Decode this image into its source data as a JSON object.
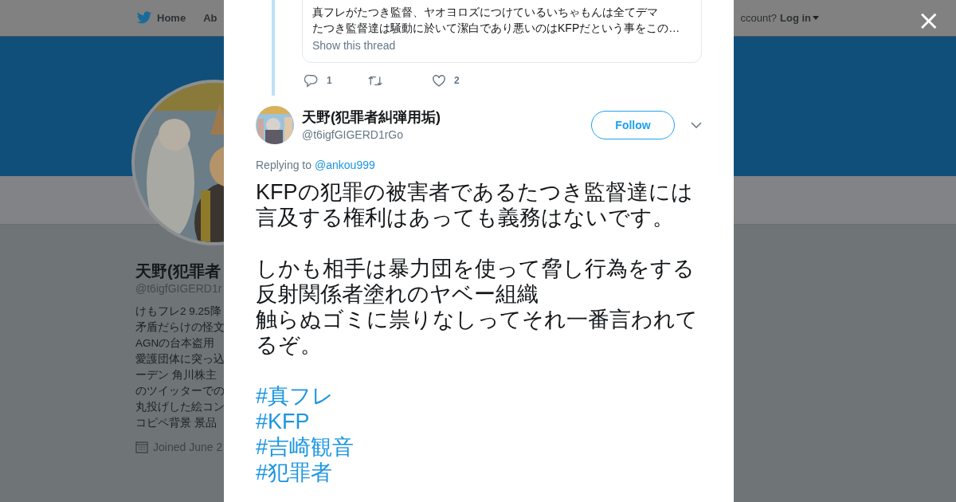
{
  "background_page": {
    "nav": {
      "home": "Home",
      "about": "Ab",
      "account_prompt": "ccount?",
      "login": "Log in"
    },
    "profile": {
      "name": "天野(犯罪者",
      "handle": "@t6igfGIGERD1r",
      "bio_lines": [
        "けもフレ2 9.25降",
        "矛盾だらけの怪文",
        "AGNの台本盗用",
        "愛護団体に突っ込",
        "ーデン 角川株主",
        "のツイッターでの",
        "丸投げした絵コン",
        "コピペ背景 景品"
      ],
      "joined": "Joined June 2"
    }
  },
  "modal": {
    "close": "×",
    "quoted_tweet": {
      "lines": [
        "真フレがたつき監督、ヤオヨロズにつけているいちゃもんは全てデマ",
        "たつき監督達は騒動に於いて潔白であり悪いのはKFPだという事をこの…"
      ],
      "show_thread": "Show this thread"
    },
    "previous_actions": {
      "replies": "1",
      "likes": "2"
    },
    "tweet": {
      "name": "天野(犯罪者糾弾用垢)",
      "handle": "@t6igfGIGERD1rGo",
      "follow": "Follow",
      "replying_label": "Replying to",
      "replying_to": "@ankou999",
      "paragraphs": [
        [
          "KFPの犯罪の被害者であるたつき監督達には言及する権利はあっても義務はないです。"
        ],
        [
          "しかも相手は暴力団を使って脅し行為をする反射関係者塗れのヤベー組織",
          "触らぬゴミに祟りなしってそれ一番言われてるぞ。"
        ]
      ],
      "hashtags": [
        "#真フレ",
        "#KFP",
        "#吉崎観音",
        "#犯罪者"
      ]
    }
  }
}
